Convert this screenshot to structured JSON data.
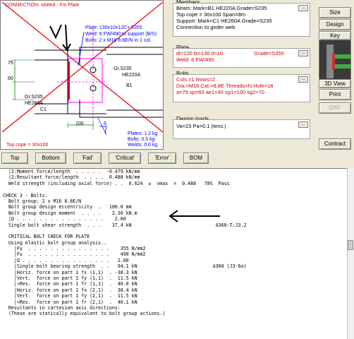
{
  "drawing": {
    "connection_label": "CONNECTION: slotted - Fin Plate",
    "plate_info": [
      "Plate: 130x10x120 • S355",
      "Weld: 6 FW/490 to support (B/S)",
      "Bolts: 2 x M16 8.8E/N in 1 col."
    ],
    "dim_75": "75",
    "dim_60": "60",
    "dim_100": "100",
    "dim_6": "6",
    "beam_grade": "Gr.S235",
    "beam_section": "HE220A",
    "beam_mark": "B1",
    "col_grade": "Gr.S235",
    "col_section": "HE260A",
    "col_mark": "C1",
    "weights": [
      "Plates: 1.2 kg",
      "Bolts:   0.5 kg",
      "Welds:  0.0 kg"
    ],
    "top_cope": "Top cope = 30x100"
  },
  "members": {
    "title": "Members",
    "lines": [
      "Beam:  Mark=B1  HE220A  Grade=S235",
      "   Top cope = 30x100  Span=8m",
      "Support:  Mark=C1  HE260A  Grade=S235",
      "   Connection to girder web"
    ]
  },
  "plate": {
    "title": "Plate",
    "line1": "di=120  bi=130  ti=10",
    "line1b": "Grade=S355",
    "line2": "Weld: 6 FW/490"
  },
  "bolts": {
    "title": "Bolts",
    "lines": [
      "Cols.=1  Rows=2",
      "Dia.=M16 Cat.=8.8E Threads=N Hole=18",
      "a=75  sp=60  ae1=40  sg1=100  sg2=70"
    ]
  },
  "loads": {
    "title": "Design loads",
    "line": "Va=23  Pa=0.1 (tens.)"
  },
  "dots_label": "...",
  "side_buttons": {
    "size": "Size",
    "design": "Design",
    "key_diagram": "Key Diagram",
    "view3d": "3D View",
    "print": "Print",
    "dxf": "DXF",
    "contract": "Contract"
  },
  "bottom_buttons": [
    "Top",
    "Bottom",
    "'Fail'",
    "'Critical'",
    "'Error'",
    "BOM"
  ],
  "report_lines": [
    "  |2:Moment force/length  . . . . .  -0.479 kN/mm",
    "  |2:Resultant force/length  . . . .  0.488 kN/mm",
    "  Weld strength (including axial force) . .  0.624  ≥  vmax  =  0.488   78%  Pass",
    "",
    "CHECK 3 - Bolts:",
    "  Bolt group: 2 x M16 8.8E/N",
    "  Bolt group design eccentricity  .   100.0 mm",
    "  Bolt group design moment  . . . .    2.30 kN.m",
    "  |Ω . . . . . . . . . . . . . . . .    2.00",
    "  Single bolt shear strength  . . .    37.4 kN                              A360-T:J3.2",
    "",
    "  CRITICAL BOLT CHECK FOR PLATE",
    "  Using elastic bolt group analysis..",
    "    |Fy  . . . . . . . . . . . . . . .    355 N/mm2",
    "    |Fu  . . . . . . . . . . . . . . .    490 N/mm2",
    "    |Ω . . . . . . . . . . . . . . . .   2.00",
    "    |Single bolt bearing strength  . .   94.1 kN                           A360 (J3-6a)",
    "    |Horiz. force on part 1 fx (1,1)  . -38.3 kN",
    "    |Vert.  force on part 1 fy (1,1)  .  11.5 kN",
    "    |»Res.  force on part 1 fr (1,1)  .  40.0 kN",
    "    |Horiz. force on part 1 fx (2,1)  .  38.4 kN",
    "    |Vert.  force on part 1 fy (2,1)  .  11.5 kN",
    "    |»Res.  force on part 1 fr (2,1)  .  40.1 kN",
    "  Resultants in cartesian axis directions:",
    "  (These are statically equivalent to bolt group actions.)"
  ]
}
